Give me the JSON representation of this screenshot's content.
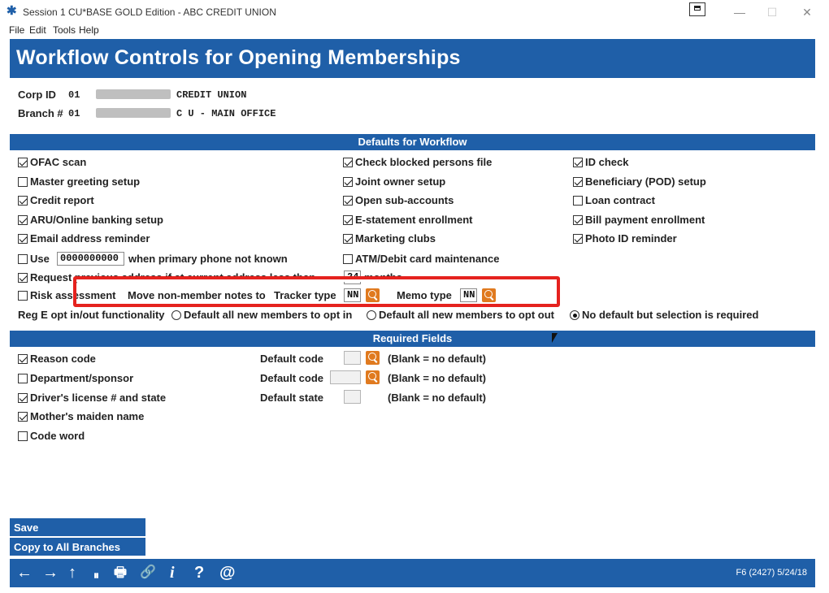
{
  "window": {
    "title": "Session 1 CU*BASE GOLD Edition - ABC CREDIT UNION",
    "minimize": "—",
    "maximize": "☐",
    "close": "✕"
  },
  "menu": [
    "File",
    "Edit",
    "Tools",
    "Help"
  ],
  "heading": "Workflow Controls for Opening Memberships",
  "corp": {
    "corp_label": "Corp ID",
    "corp_value": "01",
    "corp_name": "CREDIT UNION",
    "branch_label": "Branch #",
    "branch_value": "01",
    "branch_name": "C U - MAIN OFFICE"
  },
  "sections": {
    "defaults": "Defaults for Workflow",
    "required": "Required Fields"
  },
  "defaults": {
    "col1": [
      {
        "label": "OFAC scan",
        "checked": true
      },
      {
        "label": "Master greeting setup",
        "checked": false
      },
      {
        "label": "Credit report",
        "checked": true
      },
      {
        "label": "ARU/Online banking setup",
        "checked": true
      },
      {
        "label": "Email address reminder",
        "checked": true
      }
    ],
    "col2": [
      {
        "label": "Check blocked persons file",
        "checked": true
      },
      {
        "label": "Joint owner setup",
        "checked": true
      },
      {
        "label": "Open sub-accounts",
        "checked": true
      },
      {
        "label": "E-statement enrollment",
        "checked": true
      },
      {
        "label": "Marketing clubs",
        "checked": true
      },
      {
        "label": "ATM/Debit card maintenance",
        "checked": false
      }
    ],
    "col3": [
      {
        "label": "ID check",
        "checked": true
      },
      {
        "label": "Beneficiary (POD) setup",
        "checked": true
      },
      {
        "label": "Loan contract",
        "checked": false
      },
      {
        "label": "Bill payment enrollment",
        "checked": true
      },
      {
        "label": "Photo ID reminder",
        "checked": true
      }
    ],
    "use_label": "Use",
    "use_value": "0000000000",
    "use_suffix": "when primary phone not known",
    "request_prev_label": "Request previous address if at current address less than",
    "months_value": "24",
    "months_label": "months",
    "risk_label": "Risk assessment",
    "move_notes_label": "Move non-member notes to",
    "tracker_label": "Tracker type",
    "tracker_value": "NN",
    "memo_label": "Memo type",
    "memo_value": "NN",
    "rege_label": "Reg E opt in/out functionality",
    "rege_options": [
      {
        "label": "Default all new members to opt in",
        "selected": false
      },
      {
        "label": "Default all new members to opt out",
        "selected": false
      },
      {
        "label": "No default but selection is required",
        "selected": true
      }
    ]
  },
  "required": {
    "rows": [
      {
        "label": "Reason code",
        "checked": true,
        "field_label": "Default code",
        "note": "(Blank = no default)"
      },
      {
        "label": "Department/sponsor",
        "checked": false,
        "field_label": "Default code",
        "note": "(Blank = no default)"
      },
      {
        "label": "Driver's license # and state",
        "checked": true,
        "field_label": "Default state",
        "note": "(Blank = no default)"
      },
      {
        "label": "Mother's maiden name",
        "checked": true
      },
      {
        "label": "Code word",
        "checked": false
      }
    ]
  },
  "actions": {
    "save": "Save",
    "copy": "Copy to All Branches"
  },
  "footer": {
    "status": "F6 (2427) 5/24/18",
    "icons": [
      "←",
      "→",
      "↑",
      "⏸",
      "🖶",
      "🔗",
      "i",
      "?",
      "@"
    ]
  },
  "colors": {
    "brand_blue": "#1f5fa8",
    "lookup_orange": "#e07a1f",
    "highlight_red": "#e5221e"
  }
}
